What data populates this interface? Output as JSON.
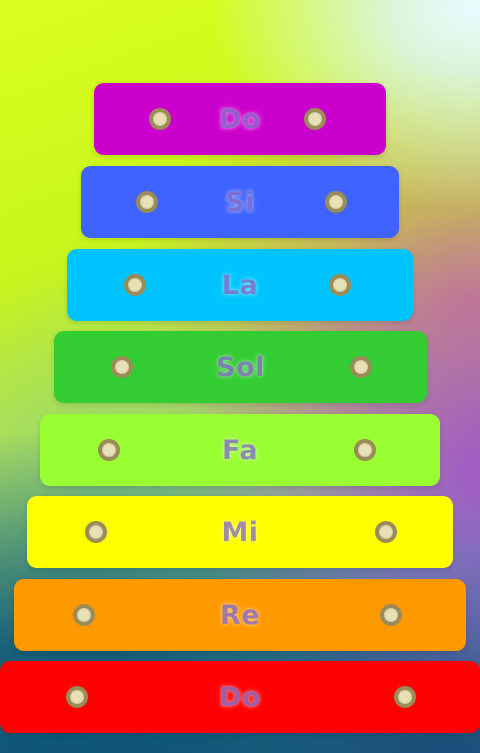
{
  "bars": [
    {
      "label": "Do",
      "color": "#cc00cc"
    },
    {
      "label": "Si",
      "color": "#3e63ff"
    },
    {
      "label": "La",
      "color": "#00c4ff"
    },
    {
      "label": "Sol",
      "color": "#33cc33"
    },
    {
      "label": "Fa",
      "color": "#99ff33"
    },
    {
      "label": "Mi",
      "color": "#ffff00"
    },
    {
      "label": "Re",
      "color": "#ff9900"
    },
    {
      "label": "Do",
      "color": "#ff0000"
    }
  ],
  "rivet_icon": "rivet-icon"
}
